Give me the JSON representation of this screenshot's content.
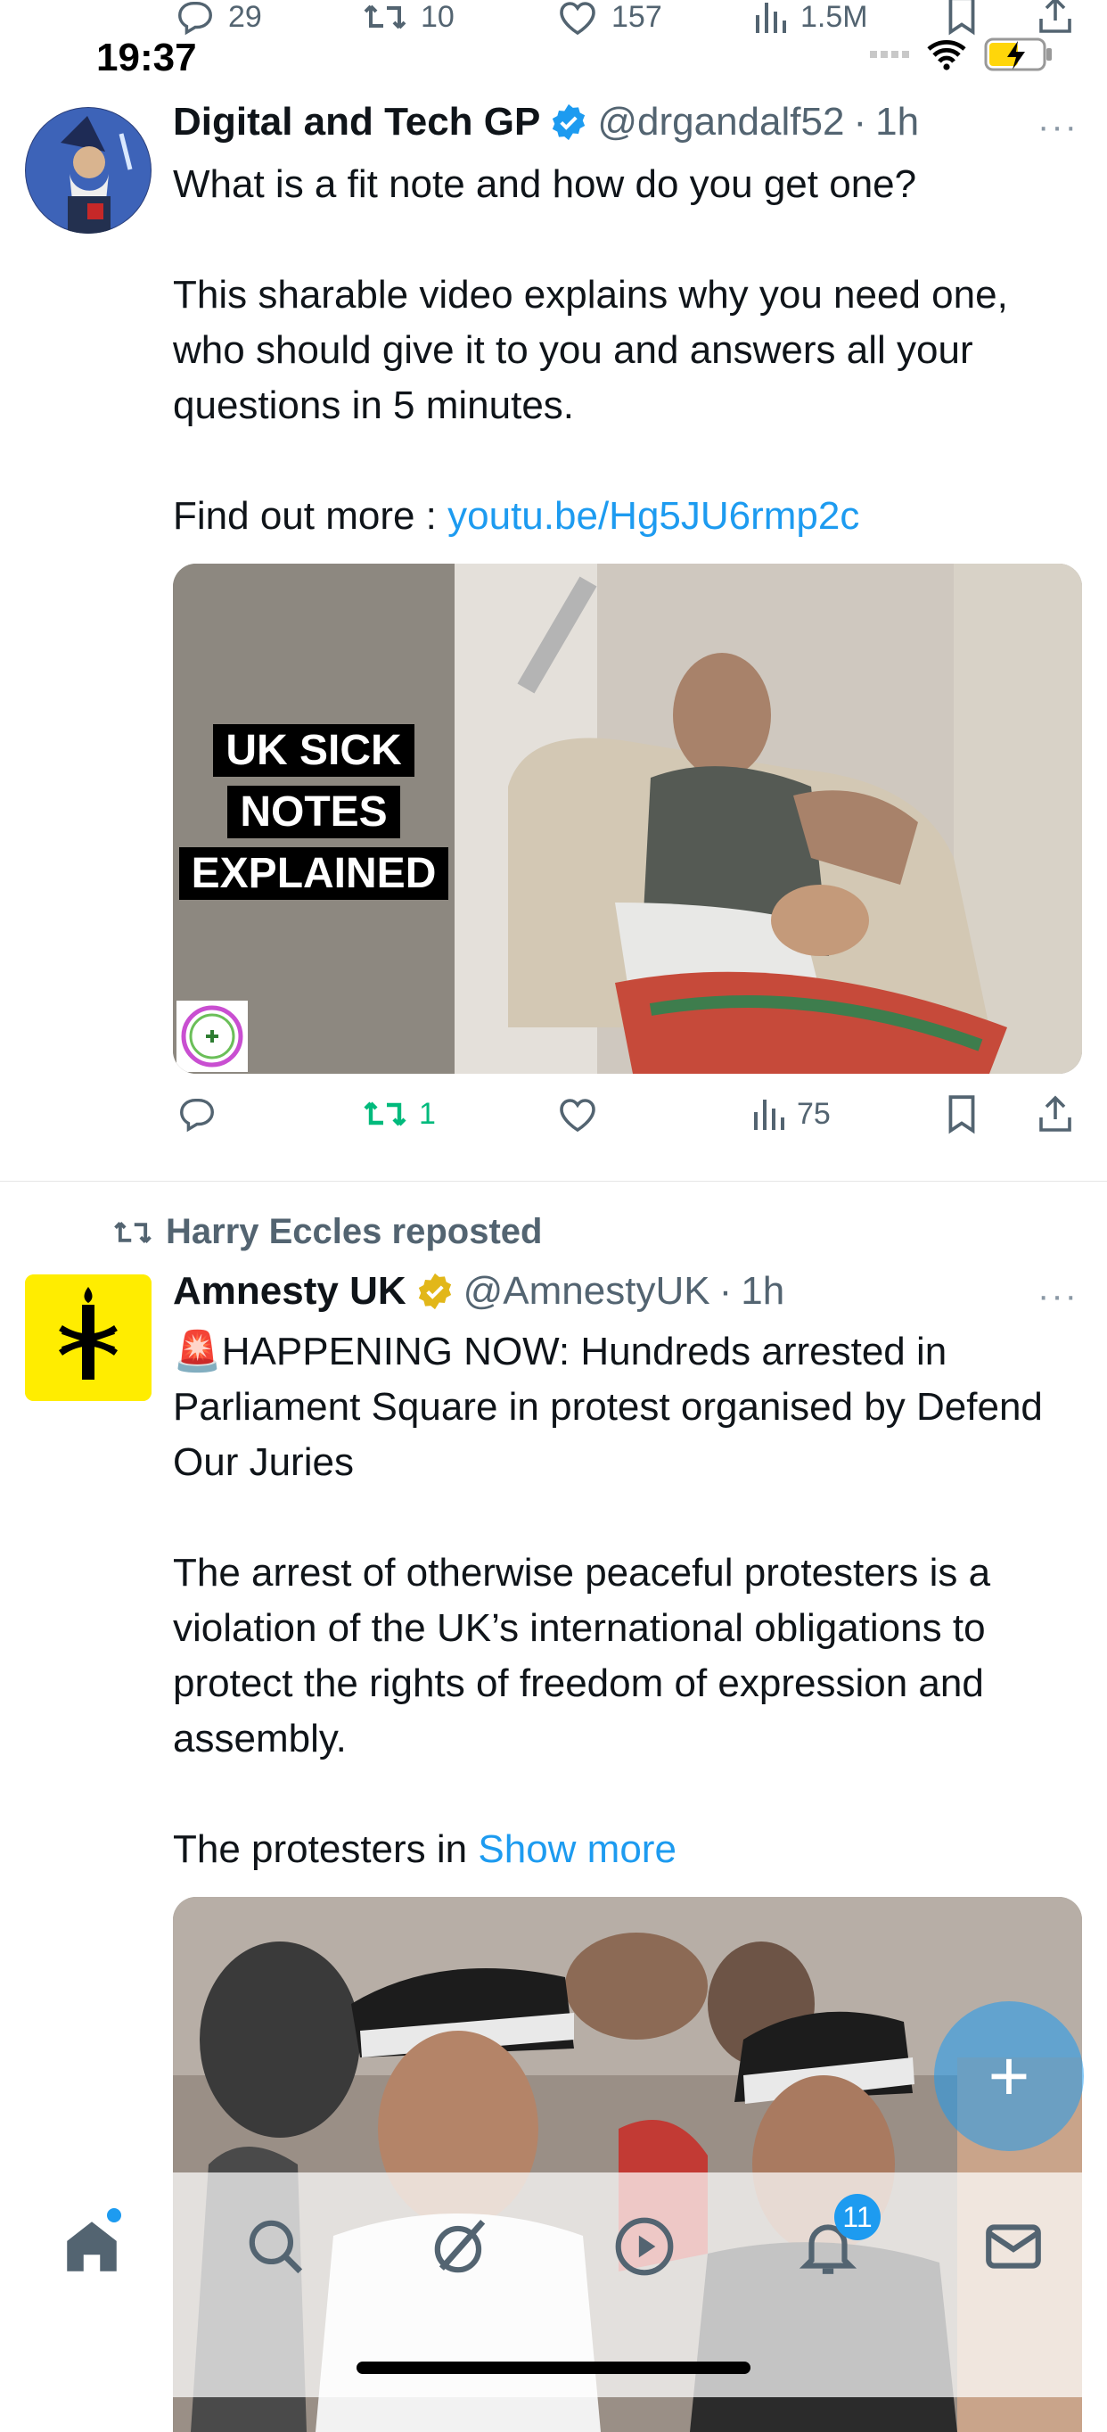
{
  "status_bar": {
    "time": "19:37"
  },
  "previous_tweet_actions": {
    "replies": "29",
    "reposts": "10",
    "likes": "157",
    "views": "1.5M"
  },
  "tweets": [
    {
      "display_name": "Digital and Tech GP",
      "handle": "@drgandalf52",
      "separator": "·",
      "time": "1h",
      "more": "···",
      "paragraphs": [
        "What is a fit note and how do you get one?",
        "This sharable video explains why you need one, who should give it to you and answers all your questions in 5 minutes."
      ],
      "link_prefix": "Find out more : ",
      "link_text": "youtu.be/Hg5JU6rmp2c",
      "media_caption_lines": [
        "UK SICK",
        "NOTES",
        "EXPLAINED"
      ],
      "actions": {
        "replies": "",
        "reposts": "1",
        "likes": "",
        "views": "75"
      },
      "colors": {
        "repost_active": "#00ba7c"
      }
    },
    {
      "reposted_by": "Harry Eccles reposted",
      "display_name": "Amnesty UK",
      "handle": "@AmnestyUK",
      "separator": "·",
      "time": "1h",
      "more": "···",
      "paragraphs": [
        "🚨HAPPENING NOW: Hundreds arrested in Parliament Square in protest organised by Defend Our Juries",
        "The arrest of otherwise peaceful protesters is a violation of the UK’s international obligations to protect the rights of freedom of expression and assembly."
      ],
      "truncated_prefix": "The protesters in ",
      "show_more": "Show more"
    }
  ],
  "nav": {
    "items": [
      "home-icon",
      "search-icon",
      "grok-icon",
      "video-icon",
      "notifications-icon",
      "messages-icon"
    ],
    "notification_badge": "11"
  },
  "fab": {
    "label": "+"
  },
  "colors": {
    "link": "#1d9bf0",
    "verified_blue": "#1d9bf0",
    "verified_gold": "#e2b719",
    "secondary_text": "#536471"
  }
}
